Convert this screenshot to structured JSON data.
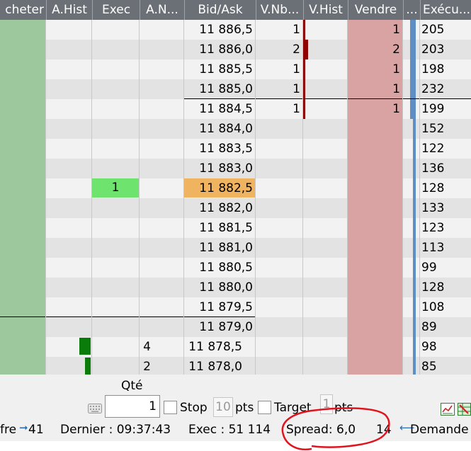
{
  "columns": [
    "cheter",
    "A.Hist",
    "Exec",
    "A.N...",
    "Bid/Ask",
    "V.Nb...",
    "V.Hist",
    "Vendre",
    "...",
    "Exécu..."
  ],
  "rows": [
    {
      "price": "11 886,5",
      "vnb": "1",
      "vendre": "1",
      "execu": "205"
    },
    {
      "price": "11 886,0",
      "vnb": "2",
      "vendre": "2",
      "execu": "203"
    },
    {
      "price": "11 885,5",
      "vnb": "1",
      "vendre": "1",
      "execu": "198"
    },
    {
      "price": "11 885,0",
      "vnb": "1",
      "vendre": "1",
      "execu": "232"
    },
    {
      "price": "11 884,5",
      "vnb": "1",
      "vendre": "1",
      "execu": "199"
    },
    {
      "price": "11 884,0",
      "execu": "152"
    },
    {
      "price": "11 883,5",
      "execu": "122"
    },
    {
      "price": "11 883,0",
      "execu": "136"
    },
    {
      "price": "11 882,5",
      "exec": "1",
      "execu": "128"
    },
    {
      "price": "11 882,0",
      "execu": "133"
    },
    {
      "price": "11 881,5",
      "execu": "123"
    },
    {
      "price": "11 881,0",
      "execu": "113"
    },
    {
      "price": "11 880,5",
      "execu": "99"
    },
    {
      "price": "11 880,0",
      "execu": "128"
    },
    {
      "price": "11 879,5",
      "execu": "108"
    },
    {
      "price": "11 879,0",
      "execu": "89"
    },
    {
      "price": "11 878,5",
      "an": "4",
      "execu": "98"
    },
    {
      "price": "11 878,0",
      "an": "2",
      "execu": "85"
    }
  ],
  "controls": {
    "qty_label": "Qté",
    "qty_value": "1",
    "stop_label": "Stop",
    "stop_value": "10",
    "stop_unit": "pts",
    "target_label": "Target",
    "target_value": "1",
    "target_unit": "pts",
    "keyboard_icon": "keyboard-icon",
    "chart_icon": "chart-icon",
    "settings_icon": "grid-settings-icon"
  },
  "status": {
    "offre_label": "fre",
    "offre_value": "41",
    "dernier": "Dernier : 09:37:43",
    "exec": "Exec : 51 114",
    "spread": "Spread: 6,0",
    "demande_value": "14",
    "demande_label": "Demande"
  },
  "colors": {
    "header_bg": "#6b6f76",
    "buy": "#9dc89d",
    "sell": "#d9a3a3",
    "current_price": "#f0b461",
    "exec_fill": "#6ee36e",
    "volume_bar": "#8f0000",
    "annotation": "#e0141e"
  }
}
